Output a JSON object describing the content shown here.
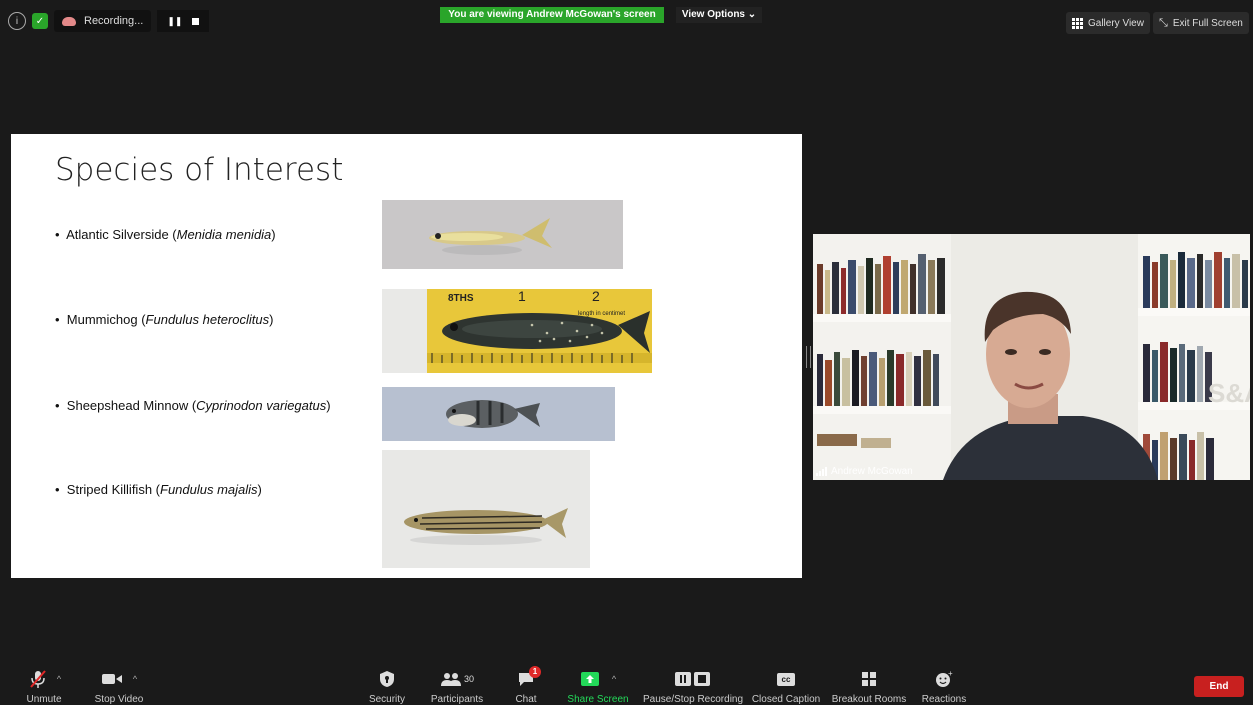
{
  "top": {
    "recording_label": "Recording...",
    "viewing_banner": "You are viewing Andrew McGowan's screen",
    "view_options": "View Options ⌄",
    "gallery_view": "Gallery View",
    "exit_full_screen": "Exit Full Screen"
  },
  "slide": {
    "title": "Species of Interest",
    "items": [
      {
        "bullet": "•",
        "common": "Atlantic Silverside (",
        "latin": "Menidia menidia",
        "close": ")"
      },
      {
        "bullet": "•",
        "common": "Mummichog (",
        "latin": "Fundulus heteroclitus",
        "close": ")"
      },
      {
        "bullet": "•",
        "common": "Sheepshead Minnow (",
        "latin": "Cyprinodon variegatus",
        "close": ")"
      },
      {
        "bullet": "•",
        "common": "Striped Killifish (",
        "latin": "Fundulus majalis",
        "close": ")"
      }
    ],
    "ruler_text": "8THS",
    "ruler_num1": "1",
    "ruler_num2": "2",
    "ruler_small": "length in centimet"
  },
  "video": {
    "participant_name": "Andrew McGowan",
    "shelf_sign": "S&A"
  },
  "toolbar": {
    "unmute": "Unmute",
    "stop_video": "Stop Video",
    "security": "Security",
    "participants": "Participants",
    "participants_count": "30",
    "chat": "Chat",
    "chat_badge": "1",
    "share_screen": "Share Screen",
    "pause_stop_recording": "Pause/Stop Recording",
    "closed_caption": "Closed Caption",
    "cc_icon": "cc",
    "breakout_rooms": "Breakout Rooms",
    "reactions": "Reactions",
    "end": "End"
  },
  "colors": {
    "banner_green": "#2aa52a",
    "share_green": "#23d959",
    "end_red": "#c8201f",
    "chat_badge_red": "#e02828"
  }
}
